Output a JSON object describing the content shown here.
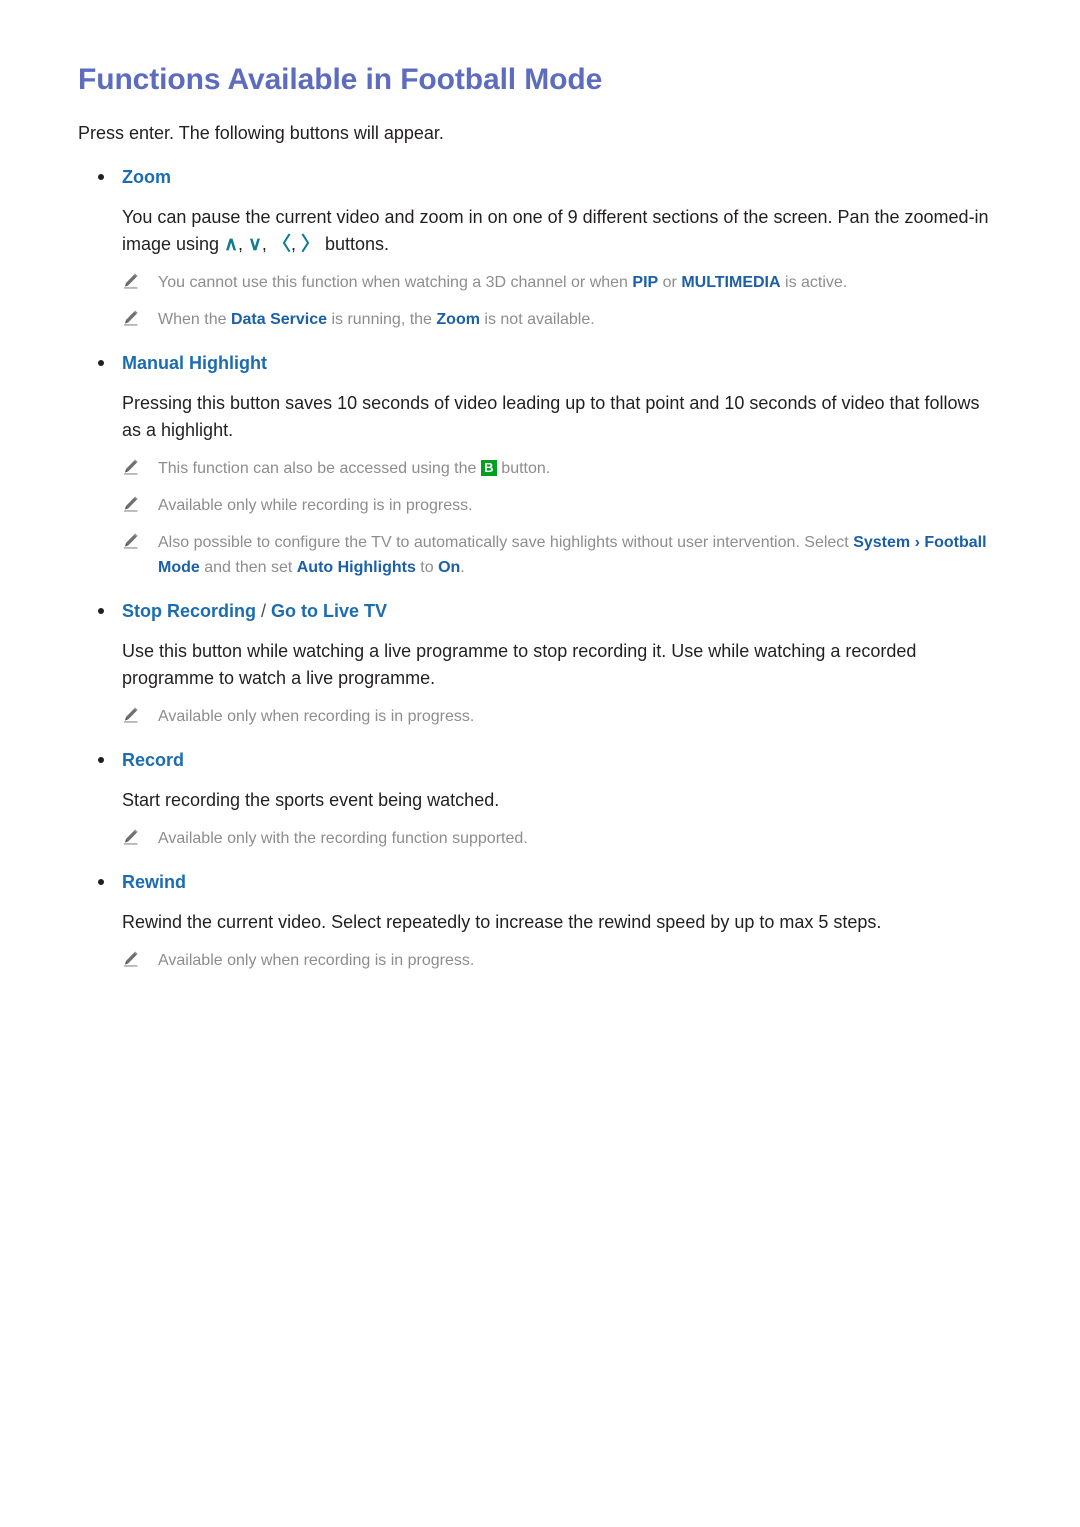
{
  "document": {
    "title": "Functions Available in Football Mode",
    "intro": "Press enter. The following buttons will appear.",
    "title_color": "#5d6cbe",
    "heading_color": "#1b6cb0",
    "note_color": "#8d8d8d",
    "accent_color": "#1a5fa8",
    "chevron_color": "#0f7c93",
    "keycap_color": "#00a11e"
  },
  "sections": [
    {
      "heading": "Zoom",
      "body_part1": "You can pause the current video and zoom in on one of 9 different sections of the screen. Pan the zoomed-in image using ",
      "chev_up": "∧",
      "chev_sep1": ", ",
      "chev_down": "∨",
      "chev_sep2": ", ",
      "chev_left": "〈",
      "chev_sep3": ", ",
      "chev_right": "〉",
      "body_part2": " buttons.",
      "notes": [
        {
          "t1": "You cannot use this function when watching a 3D channel or when ",
          "hl1": "PIP",
          "t2": " or ",
          "hl2": "MULTIMEDIA",
          "t3": " is active."
        },
        {
          "t1": "When the ",
          "hl1": "Data Service",
          "t2": " is running, the ",
          "hl2": "Zoom",
          "t3": " is not available."
        }
      ]
    },
    {
      "heading": "Manual Highlight",
      "body": "Pressing this button saves 10 seconds of video leading up to that point and 10 seconds of video that follows as a highlight.",
      "notes": [
        {
          "t1": "This function can also be accessed using the ",
          "keycap": "B",
          "t2": " button."
        },
        {
          "t1": "Available only while recording is in progress."
        },
        {
          "t1": "Also possible to configure the TV to automatically save highlights without user intervention. Select ",
          "hl1": "System",
          "sep1": " › ",
          "hl2": "Football Mode",
          "t2": " and then set ",
          "hl3": "Auto Highlights",
          "t3": " to ",
          "hl4": "On",
          "t4": "."
        }
      ]
    },
    {
      "heading_a": "Stop Recording",
      "heading_sep": " / ",
      "heading_b": "Go to Live TV",
      "body": "Use this button while watching a live programme to stop recording it. Use while watching a recorded programme to watch a live programme.",
      "notes": [
        {
          "t1": "Available only when recording is in progress."
        }
      ]
    },
    {
      "heading": "Record",
      "body": "Start recording the sports event being watched.",
      "notes": [
        {
          "t1": "Available only with the recording function supported."
        }
      ]
    },
    {
      "heading": "Rewind",
      "body": "Rewind the current video. Select repeatedly to increase the rewind speed by up to max 5 steps.",
      "notes": [
        {
          "t1": "Available only when recording is in progress."
        }
      ]
    }
  ],
  "icons": {
    "bullet": "bullet-dot",
    "pencil": "pencil-icon",
    "chevron_up": "chevron-up-icon",
    "chevron_down": "chevron-down-icon",
    "chevron_left": "chevron-left-icon",
    "chevron_right": "chevron-right-icon",
    "keycap_b": "green-b-button-icon"
  }
}
